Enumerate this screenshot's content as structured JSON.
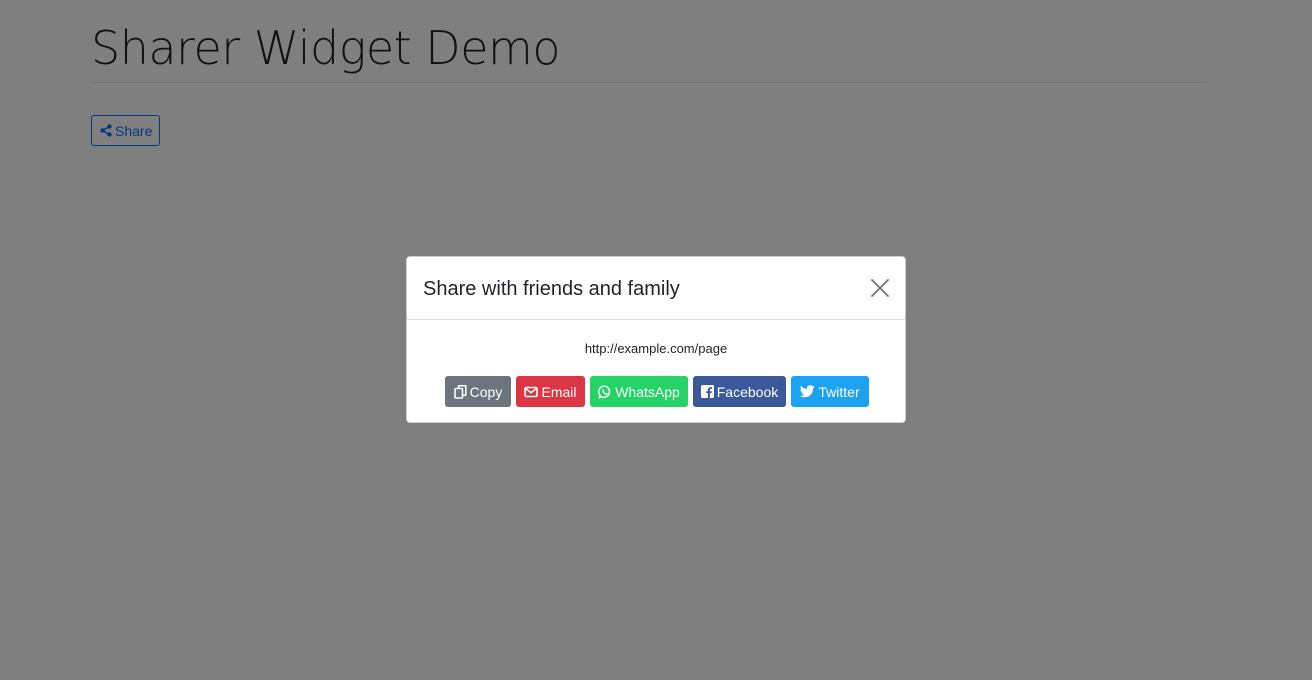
{
  "page": {
    "title": "Sharer Widget Demo",
    "share_button_label": "Share"
  },
  "modal": {
    "title": "Share with friends and family",
    "url": "http://example.com/page",
    "buttons": {
      "copy": "Copy",
      "email": "Email",
      "whatsapp": "WhatsApp",
      "facebook": "Facebook",
      "twitter": "Twitter"
    }
  },
  "colors": {
    "primary": "#0d6efd",
    "copy": "#6c757d",
    "email": "#dc3545",
    "whatsapp": "#25d366",
    "facebook": "#3b5998",
    "twitter": "#1da1f2"
  },
  "icons": {
    "share_button": "share-icon",
    "close": "close-icon",
    "copy": "copy-icon",
    "email": "envelope-icon",
    "whatsapp": "whatsapp-icon",
    "facebook": "facebook-icon",
    "twitter": "twitter-icon"
  }
}
